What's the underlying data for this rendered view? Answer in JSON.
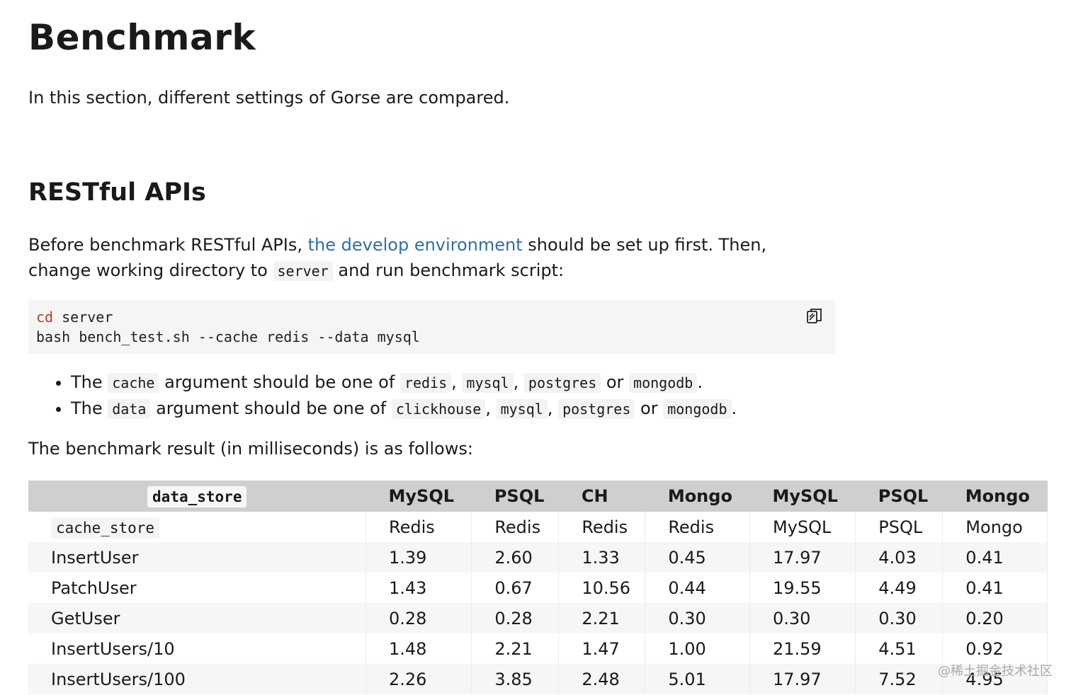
{
  "page": {
    "title": "Benchmark",
    "intro": "In this section, different settings of Gorse are compared.",
    "section_title": "RESTful APIs",
    "before_text_1": "Before benchmark RESTful APIs, ",
    "before_link": "the develop environment",
    "before_text_2": " should be set up first. Then, change working directory to ",
    "before_code": "server",
    "before_text_3": " and run benchmark script:",
    "code_line1_kw": "cd",
    "code_line1_rest": " server",
    "code_line2": "bash bench_test.sh --cache redis --data mysql",
    "copy_icon": "copy-icon",
    "bullets": [
      {
        "t1": "The ",
        "arg": "cache",
        "t2": " argument should be one of ",
        "o1": "redis",
        "s1": ", ",
        "o2": "mysql",
        "s2": ", ",
        "o3": "postgres",
        "s3": " or ",
        "o4": "mongodb",
        "end": "."
      },
      {
        "t1": "The ",
        "arg": "data",
        "t2": " argument should be one of ",
        "o1": "clickhouse",
        "s1": ", ",
        "o2": "mysql",
        "s2": ", ",
        "o3": "postgres",
        "s3": " or ",
        "o4": "mongodb",
        "end": "."
      }
    ],
    "result_intro": "The benchmark result (in milliseconds) is as follows:",
    "watermark": "@稀土掘金技术社区"
  },
  "table": {
    "header_first": "data_store",
    "headers": [
      "MySQL",
      "PSQL",
      "CH",
      "Mongo",
      "MySQL",
      "PSQL",
      "Mongo"
    ],
    "cache_label": "cache_store",
    "cache_values": [
      "Redis",
      "Redis",
      "Redis",
      "Redis",
      "MySQL",
      "PSQL",
      "Mongo"
    ],
    "rows": [
      {
        "name": "InsertUser",
        "values": [
          "1.39",
          "2.60",
          "1.33",
          "0.45",
          "17.97",
          "4.03",
          "0.41"
        ]
      },
      {
        "name": "PatchUser",
        "values": [
          "1.43",
          "0.67",
          "10.56",
          "0.44",
          "19.55",
          "4.49",
          "0.41"
        ]
      },
      {
        "name": "GetUser",
        "values": [
          "0.28",
          "0.28",
          "2.21",
          "0.30",
          "0.30",
          "0.30",
          "0.20"
        ]
      },
      {
        "name": "InsertUsers/10",
        "values": [
          "1.48",
          "2.21",
          "1.47",
          "1.00",
          "21.59",
          "4.51",
          "0.92"
        ]
      },
      {
        "name": "InsertUsers/100",
        "values": [
          "2.26",
          "3.85",
          "2.48",
          "5.01",
          "17.97",
          "7.52",
          "4.95"
        ]
      }
    ]
  }
}
